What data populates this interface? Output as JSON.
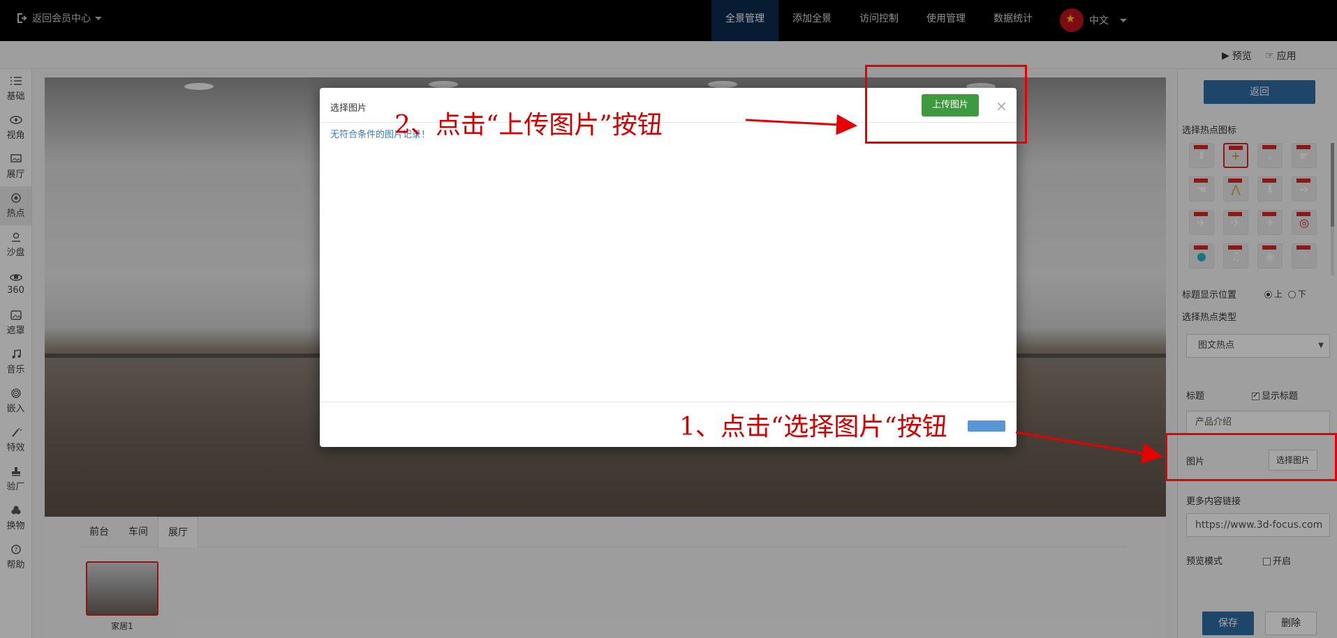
{
  "topbar": {
    "back_label": "返回会员中心",
    "nav": [
      "全景管理",
      "添加全景",
      "访问控制",
      "使用管理",
      "数据统计"
    ],
    "active_index": 0,
    "language": "中文"
  },
  "toolbar": {
    "preview": "预览",
    "apply": "应用"
  },
  "sidebar": {
    "items": [
      {
        "label": "基础",
        "icon": "list-icon"
      },
      {
        "label": "视角",
        "icon": "eye-icon"
      },
      {
        "label": "展厅",
        "icon": "image-frame-icon"
      },
      {
        "label": "热点",
        "icon": "target-icon"
      },
      {
        "label": "沙盘",
        "icon": "map-pin-icon"
      },
      {
        "label": "360",
        "icon": "rotate-360-icon"
      },
      {
        "label": "遮罩",
        "icon": "picture-icon"
      },
      {
        "label": "音乐",
        "icon": "music-icon"
      },
      {
        "label": "嵌入",
        "icon": "fingerprint-icon"
      },
      {
        "label": "特效",
        "icon": "magic-wand-icon"
      },
      {
        "label": "验厂",
        "icon": "stamp-icon"
      },
      {
        "label": "换物",
        "icon": "cubes-icon"
      },
      {
        "label": "帮助",
        "icon": "help-icon"
      }
    ],
    "active_index": 3
  },
  "scenes": {
    "tabs": [
      "前台",
      "车间",
      "展厅"
    ],
    "active_index": 2,
    "thumbnails": [
      {
        "label": "家居1"
      }
    ]
  },
  "right_panel": {
    "back_button": "返回",
    "select_icon_label": "选择热点图标",
    "title_position_label": "标题显示位置",
    "position_options": [
      "上",
      "下"
    ],
    "position_selected": 0,
    "hotspot_type_label": "选择热点类型",
    "hotspot_type_value": "图文热点",
    "title_label": "标题",
    "show_title_label": "显示标题",
    "show_title_checked": true,
    "title_value": "产品介绍",
    "image_label": "图片",
    "select_image_button": "选择图片",
    "more_link_label": "更多内容链接",
    "more_link_value": "https://www.3d-focus.com",
    "preview_mode_label": "预览模式",
    "preview_mode_option": "开启",
    "preview_mode_checked": false,
    "save_button": "保存",
    "delete_button": "删除"
  },
  "modal": {
    "title": "选择图片",
    "upload_button": "上传图片",
    "close_symbol": "×",
    "empty_message": "无符合条件的图片记录！"
  },
  "annotations": {
    "step2": "2、点击“上传图片”按钮",
    "step1": "1、点击“选择图片“按钮",
    "color": "#e60000"
  }
}
